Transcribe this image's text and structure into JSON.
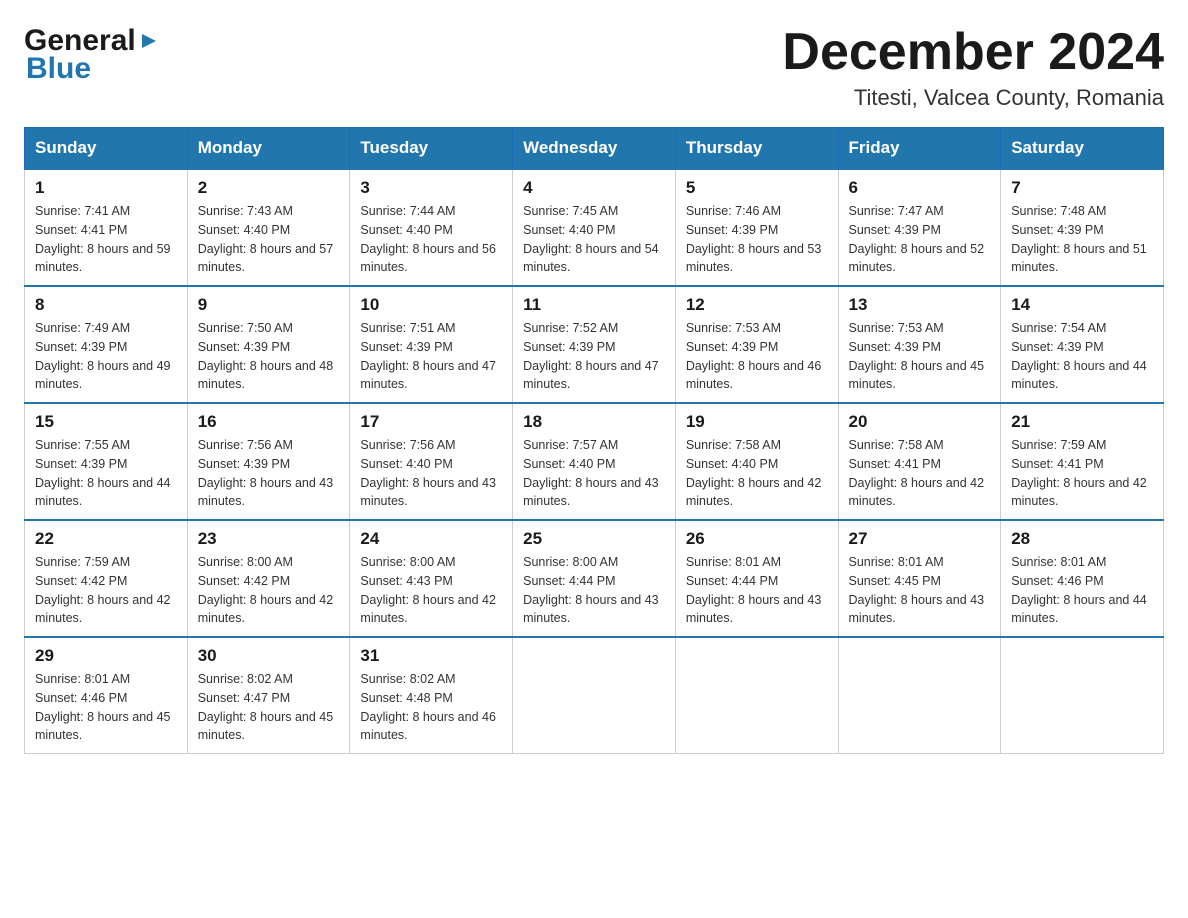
{
  "header": {
    "logo": {
      "line1": "General",
      "line2": "Blue",
      "arrow": "▶"
    },
    "title": "December 2024",
    "location": "Titesti, Valcea County, Romania"
  },
  "calendar": {
    "days_of_week": [
      "Sunday",
      "Monday",
      "Tuesday",
      "Wednesday",
      "Thursday",
      "Friday",
      "Saturday"
    ],
    "weeks": [
      [
        {
          "day": "1",
          "sunrise": "7:41 AM",
          "sunset": "4:41 PM",
          "daylight": "8 hours and 59 minutes."
        },
        {
          "day": "2",
          "sunrise": "7:43 AM",
          "sunset": "4:40 PM",
          "daylight": "8 hours and 57 minutes."
        },
        {
          "day": "3",
          "sunrise": "7:44 AM",
          "sunset": "4:40 PM",
          "daylight": "8 hours and 56 minutes."
        },
        {
          "day": "4",
          "sunrise": "7:45 AM",
          "sunset": "4:40 PM",
          "daylight": "8 hours and 54 minutes."
        },
        {
          "day": "5",
          "sunrise": "7:46 AM",
          "sunset": "4:39 PM",
          "daylight": "8 hours and 53 minutes."
        },
        {
          "day": "6",
          "sunrise": "7:47 AM",
          "sunset": "4:39 PM",
          "daylight": "8 hours and 52 minutes."
        },
        {
          "day": "7",
          "sunrise": "7:48 AM",
          "sunset": "4:39 PM",
          "daylight": "8 hours and 51 minutes."
        }
      ],
      [
        {
          "day": "8",
          "sunrise": "7:49 AM",
          "sunset": "4:39 PM",
          "daylight": "8 hours and 49 minutes."
        },
        {
          "day": "9",
          "sunrise": "7:50 AM",
          "sunset": "4:39 PM",
          "daylight": "8 hours and 48 minutes."
        },
        {
          "day": "10",
          "sunrise": "7:51 AM",
          "sunset": "4:39 PM",
          "daylight": "8 hours and 47 minutes."
        },
        {
          "day": "11",
          "sunrise": "7:52 AM",
          "sunset": "4:39 PM",
          "daylight": "8 hours and 47 minutes."
        },
        {
          "day": "12",
          "sunrise": "7:53 AM",
          "sunset": "4:39 PM",
          "daylight": "8 hours and 46 minutes."
        },
        {
          "day": "13",
          "sunrise": "7:53 AM",
          "sunset": "4:39 PM",
          "daylight": "8 hours and 45 minutes."
        },
        {
          "day": "14",
          "sunrise": "7:54 AM",
          "sunset": "4:39 PM",
          "daylight": "8 hours and 44 minutes."
        }
      ],
      [
        {
          "day": "15",
          "sunrise": "7:55 AM",
          "sunset": "4:39 PM",
          "daylight": "8 hours and 44 minutes."
        },
        {
          "day": "16",
          "sunrise": "7:56 AM",
          "sunset": "4:39 PM",
          "daylight": "8 hours and 43 minutes."
        },
        {
          "day": "17",
          "sunrise": "7:56 AM",
          "sunset": "4:40 PM",
          "daylight": "8 hours and 43 minutes."
        },
        {
          "day": "18",
          "sunrise": "7:57 AM",
          "sunset": "4:40 PM",
          "daylight": "8 hours and 43 minutes."
        },
        {
          "day": "19",
          "sunrise": "7:58 AM",
          "sunset": "4:40 PM",
          "daylight": "8 hours and 42 minutes."
        },
        {
          "day": "20",
          "sunrise": "7:58 AM",
          "sunset": "4:41 PM",
          "daylight": "8 hours and 42 minutes."
        },
        {
          "day": "21",
          "sunrise": "7:59 AM",
          "sunset": "4:41 PM",
          "daylight": "8 hours and 42 minutes."
        }
      ],
      [
        {
          "day": "22",
          "sunrise": "7:59 AM",
          "sunset": "4:42 PM",
          "daylight": "8 hours and 42 minutes."
        },
        {
          "day": "23",
          "sunrise": "8:00 AM",
          "sunset": "4:42 PM",
          "daylight": "8 hours and 42 minutes."
        },
        {
          "day": "24",
          "sunrise": "8:00 AM",
          "sunset": "4:43 PM",
          "daylight": "8 hours and 42 minutes."
        },
        {
          "day": "25",
          "sunrise": "8:00 AM",
          "sunset": "4:44 PM",
          "daylight": "8 hours and 43 minutes."
        },
        {
          "day": "26",
          "sunrise": "8:01 AM",
          "sunset": "4:44 PM",
          "daylight": "8 hours and 43 minutes."
        },
        {
          "day": "27",
          "sunrise": "8:01 AM",
          "sunset": "4:45 PM",
          "daylight": "8 hours and 43 minutes."
        },
        {
          "day": "28",
          "sunrise": "8:01 AM",
          "sunset": "4:46 PM",
          "daylight": "8 hours and 44 minutes."
        }
      ],
      [
        {
          "day": "29",
          "sunrise": "8:01 AM",
          "sunset": "4:46 PM",
          "daylight": "8 hours and 45 minutes."
        },
        {
          "day": "30",
          "sunrise": "8:02 AM",
          "sunset": "4:47 PM",
          "daylight": "8 hours and 45 minutes."
        },
        {
          "day": "31",
          "sunrise": "8:02 AM",
          "sunset": "4:48 PM",
          "daylight": "8 hours and 46 minutes."
        },
        null,
        null,
        null,
        null
      ]
    ]
  }
}
